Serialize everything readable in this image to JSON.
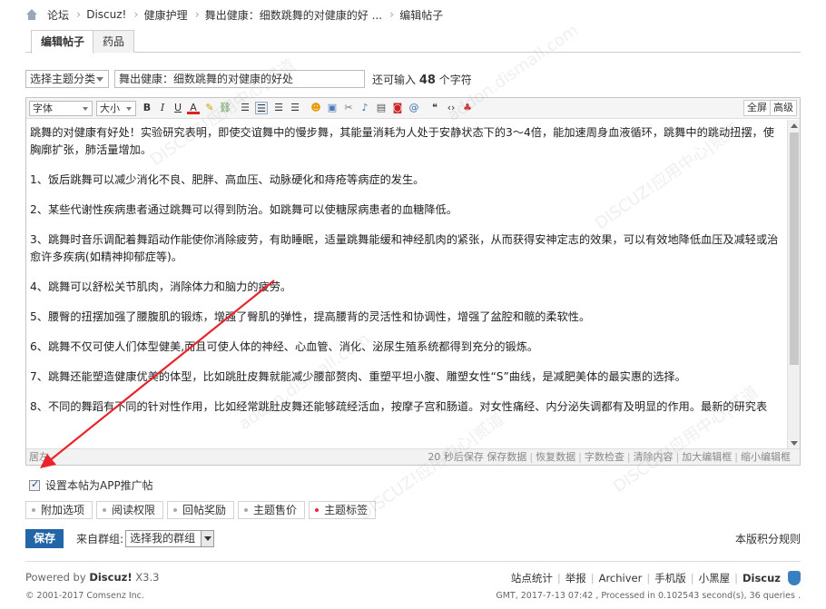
{
  "breadcrumb": {
    "items": [
      "论坛",
      "Discuz!",
      "健康护理",
      "舞出健康：细数跳舞的对健康的好 ...",
      "编辑帖子"
    ]
  },
  "tabs": [
    "编辑帖子",
    "药品"
  ],
  "titlebar": {
    "category_select": "选择主题分类",
    "title_value": "舞出健康：细数跳舞的对健康的好处",
    "remaining_prefix": "还可输入",
    "remaining_count": "48",
    "remaining_suffix": "个字符"
  },
  "toolbar": {
    "font_select": "字体",
    "size_select": "大小",
    "fullscreen": "全屏",
    "advanced": "高级"
  },
  "content": {
    "paragraphs": [
      "跳舞的对健康有好处！实验研究表明，即使交谊舞中的慢步舞，其能量消耗为人处于安静状态下的3～4倍，能加速周身血液循环，跳舞中的跳动扭摆，使胸廓扩张，肺活量增加。",
      "1、饭后跳舞可以减少消化不良、肥胖、高血压、动脉硬化和痔疮等病症的发生。",
      "2、某些代谢性疾病患者通过跳舞可以得到防治。如跳舞可以使糖尿病患者的血糖降低。",
      "3、跳舞时音乐调配着舞蹈动作能使你消除疲劳，有助睡眠，适量跳舞能缓和神经肌肉的紧张，从而获得安神定志的效果，可以有效地降低血压及减轻或治愈许多疾病(如精神抑郁症等)。",
      "4、跳舞可以舒松关节肌肉，消除体力和脑力的疲劳。",
      "5、腰臀的扭摆加强了腰腹肌的锻炼，增强了臀肌的弹性，提高腰背的灵活性和协调性，增强了盆腔和髋的柔软性。",
      "6、跳舞不仅可使人们体型健美,而且可使人体的神经、心血管、消化、泌尿生殖系统都得到充分的锻炼。",
      "7、跳舞还能塑造健康优美的体型，比如跳肚皮舞就能减少腰部赘肉、重塑平坦小腹、雕塑女性“S”曲线，是减肥美体的最实惠的选择。",
      "8、不同的舞蹈有不同的针对性作用，比如经常跳肚皮舞还能够疏经活血，按摩子宫和肠道。对女性痛经、内分泌失调都有及明显的作用。最新的研究表"
    ]
  },
  "statusbar": {
    "left": "居左",
    "autosave": "20 秒后保存",
    "save": "保存数据",
    "restore": "恢复数据",
    "check": "字数检查",
    "clear": "清除内容",
    "enlarge": "加大编辑框",
    "shrink": "缩小编辑框"
  },
  "options": {
    "app_promo": "设置本帖为APP推广帖",
    "buttons": [
      "附加选项",
      "阅读权限",
      "回帖奖励",
      "主题售价",
      "主题标签"
    ]
  },
  "post": {
    "submit": "保存",
    "group_label": "来自群组:",
    "group_select": "选择我的群组",
    "rules": "本版积分规则"
  },
  "footer": {
    "powered_prefix": "Powered by",
    "powered_brand": "Discuz!",
    "version": "X3.3",
    "copyright": "© 2001-2017 Comsenz Inc.",
    "links": [
      "站点统计",
      "举报",
      "Archiver",
      "手机版",
      "小黑屋",
      "Discuz"
    ],
    "gmt": "GMT, 2017-7-13 07:42 , Processed in 0.102543 second(s), 36 queries ."
  },
  "watermark": [
    "DISCUZ!应用中心|贰道",
    "addon.dismall.com"
  ],
  "colors": {
    "accent": "#2366a8",
    "arrow": "#e8242c"
  }
}
